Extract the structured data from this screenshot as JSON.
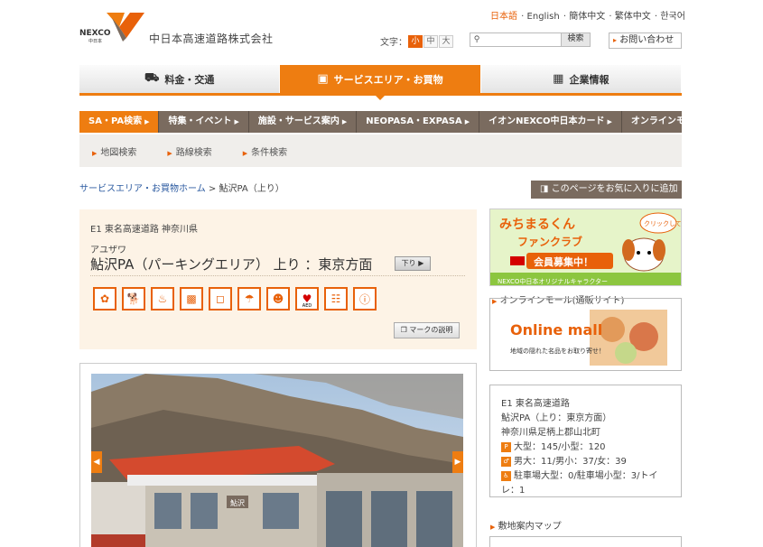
{
  "header": {
    "company_name": "中日本高速道路株式会社",
    "logo_text": "NEXCO",
    "logo_sub": "中日本",
    "languages": [
      "日本語",
      "English",
      "簡体中文",
      "繁体中文",
      "한국어"
    ],
    "text_size_label": "文字：",
    "text_sizes": [
      "小",
      "中",
      "大"
    ],
    "search_button": "検索",
    "contact_label": "お問い合わせ"
  },
  "main_nav": [
    {
      "label": "料金・交通",
      "icon": "car-icon"
    },
    {
      "label": "サービスエリア・お買物",
      "icon": "shopping-bag-icon"
    },
    {
      "label": "企業情報",
      "icon": "building-icon"
    }
  ],
  "sub_nav": [
    "SA・PA検索",
    "特集・イベント",
    "施設・サービス案内",
    "NEOPASA・EXPASA",
    "イオンNEXCO中日本カード",
    "オンラインモール"
  ],
  "sub_nav2": [
    "地図検索",
    "路線検索",
    "条件検索"
  ],
  "breadcrumb": {
    "home": "サービスエリア・お買物ホーム",
    "sep": ">",
    "current": "鮎沢PA（上り）"
  },
  "favorite_button": "このページをお気に入りに追加",
  "pa": {
    "route": "E1 東名高速道路 神奈川県",
    "kana": "アユザワ",
    "name": "鮎沢PA（パーキングエリア） 上り ：東京方面",
    "direction_button": "下り",
    "aed_label": "AED",
    "mark_button": "マークの説明"
  },
  "photo": {
    "store_sign": "鮎沢"
  },
  "banner": {
    "title": "みちまるくん",
    "subtitle": "ファンクラブ",
    "recruit": "会員募集中！",
    "bubble": "クリックしてね",
    "footer": "NEXCO中日本オリジナルキャラクター"
  },
  "mall": {
    "heading": "オンラインモール(通販サイト)",
    "logo": "Online mall",
    "caption": "地域の隠れた名品をお取り寄せ！"
  },
  "info": {
    "route": "E1 東名高速道路",
    "name": "鮎沢PA（上り：東京方面）",
    "address": "神奈川県足柄上郡山北町",
    "parking": "大型：145/小型：120",
    "toilet": "男大：11/男小：37/女：39",
    "disabled_a": "駐車場大型：0/駐車場小型：3/トイ",
    "disabled_b": "レ：1"
  },
  "map_heading": "敷地案内マップ"
}
